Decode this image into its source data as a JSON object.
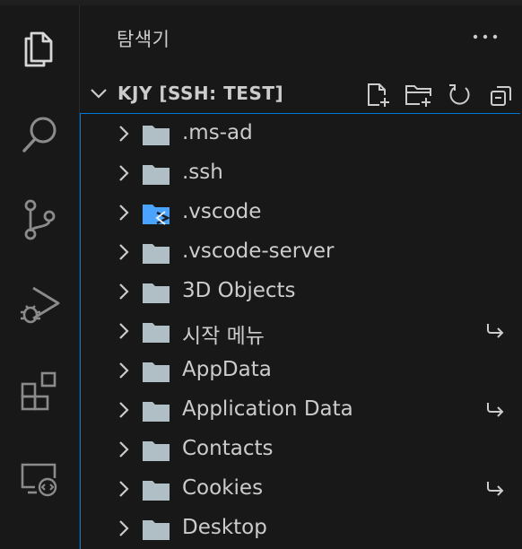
{
  "sidebar": {
    "title": "탐색기",
    "section_title": "KJY [SSH: TEST]",
    "tree": [
      {
        "label": ".ms-ad",
        "icon": "folder-icon",
        "symlink": false
      },
      {
        "label": ".ssh",
        "icon": "folder-icon",
        "symlink": false
      },
      {
        "label": ".vscode",
        "icon": "vscode-folder-icon",
        "symlink": false
      },
      {
        "label": ".vscode-server",
        "icon": "folder-icon",
        "symlink": false
      },
      {
        "label": "3D Objects",
        "icon": "folder-icon",
        "symlink": false
      },
      {
        "label": "시작 메뉴",
        "icon": "folder-icon",
        "symlink": true
      },
      {
        "label": "AppData",
        "icon": "folder-icon",
        "symlink": false
      },
      {
        "label": "Application Data",
        "icon": "folder-icon",
        "symlink": true
      },
      {
        "label": "Contacts",
        "icon": "folder-icon",
        "symlink": false
      },
      {
        "label": "Cookies",
        "icon": "folder-icon",
        "symlink": true
      },
      {
        "label": "Desktop",
        "icon": "folder-icon",
        "symlink": false
      }
    ]
  },
  "activity_bar": [
    "explorer-icon",
    "search-icon",
    "source-control-icon",
    "run-debug-icon",
    "extensions-icon",
    "remote-explorer-icon"
  ],
  "colors": {
    "folder": "#b0bec5",
    "vscode_folder": "#4aa3ff",
    "focus_border": "#0078d4",
    "text": "#cccccc",
    "background": "#181818"
  }
}
